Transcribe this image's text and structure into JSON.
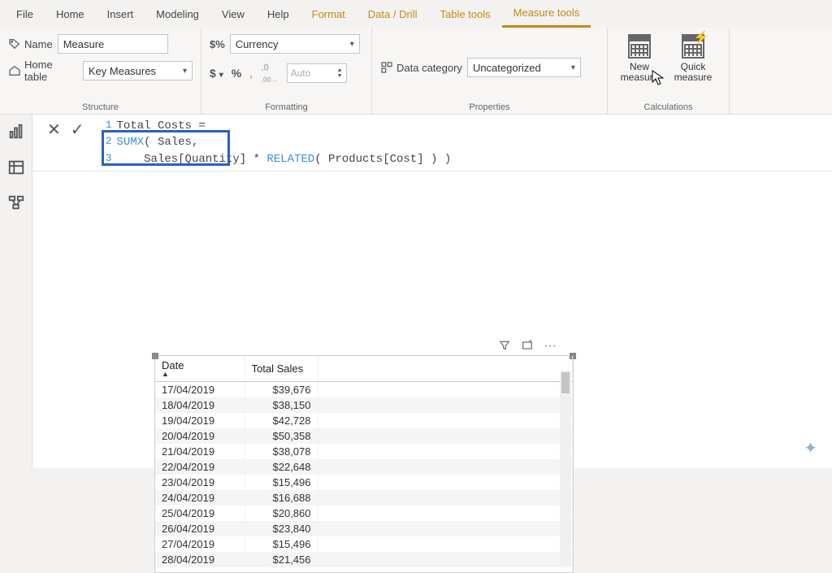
{
  "menu": {
    "file": "File",
    "home": "Home",
    "insert": "Insert",
    "modeling": "Modeling",
    "view": "View",
    "help": "Help",
    "format": "Format",
    "datadrill": "Data / Drill",
    "tabletools": "Table tools",
    "measuretools": "Measure tools"
  },
  "structure": {
    "name_lbl": "Name",
    "name_val": "Measure",
    "home_lbl": "Home table",
    "home_val": "Key Measures",
    "group": "Structure"
  },
  "formatting": {
    "format_val": "Currency",
    "dollar": "$",
    "percent": "%",
    "comma": ",",
    "auto": "Auto",
    "group": "Formatting"
  },
  "properties": {
    "datacat_lbl": "Data category",
    "datacat_val": "Uncategorized",
    "group": "Properties"
  },
  "calculations": {
    "new_lbl": "New measure",
    "quick_lbl": "Quick measure",
    "group": "Calculations"
  },
  "formula": {
    "lines": [
      {
        "n": "1",
        "a": "Total Costs = "
      },
      {
        "n": "2",
        "fn": "SUMX",
        "a": "( Sales,"
      },
      {
        "n": "3",
        "a": "    Sales[Quantity] ",
        "b": "* ",
        "fn2": "RELATED",
        "c": "( Products[Cost] ) )"
      }
    ]
  },
  "visual": {
    "headers": {
      "date": "Date",
      "sales": "Total Sales"
    },
    "rows": [
      {
        "d": "17/04/2019",
        "v": "$39,676"
      },
      {
        "d": "18/04/2019",
        "v": "$38,150"
      },
      {
        "d": "19/04/2019",
        "v": "$42,728"
      },
      {
        "d": "20/04/2019",
        "v": "$50,358"
      },
      {
        "d": "21/04/2019",
        "v": "$38,078"
      },
      {
        "d": "22/04/2019",
        "v": "$22,648"
      },
      {
        "d": "23/04/2019",
        "v": "$15,496"
      },
      {
        "d": "24/04/2019",
        "v": "$16,688"
      },
      {
        "d": "25/04/2019",
        "v": "$20,860"
      },
      {
        "d": "26/04/2019",
        "v": "$23,840"
      },
      {
        "d": "27/04/2019",
        "v": "$15,496"
      },
      {
        "d": "28/04/2019",
        "v": "$21,456"
      }
    ]
  }
}
